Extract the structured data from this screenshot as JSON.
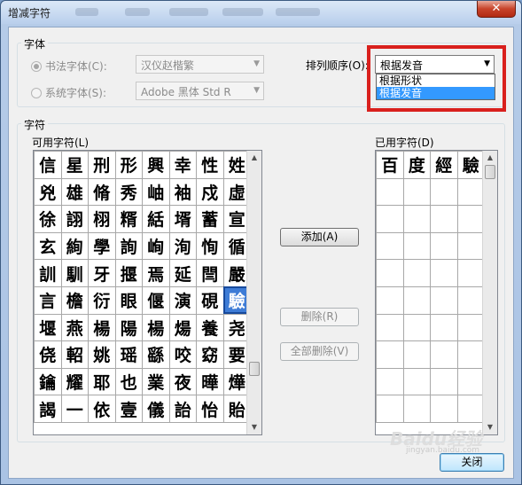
{
  "window": {
    "title": "增减字符",
    "close_glyph": "✕"
  },
  "font_group": {
    "label": "字体",
    "calligraphy_radio": "书法字体(C):",
    "calligraphy_value": "汉仪赵楷繁",
    "system_radio": "系统字体(S):",
    "system_value": "Adobe 黑体 Std R",
    "sort_label": "排列顺序(O):",
    "sort_value": "根据发音",
    "sort_options": [
      "根据形状",
      "根据发音"
    ]
  },
  "char_group": {
    "label": "字符",
    "available_label": "可用字符(L)",
    "used_label": "已用字符(D)",
    "available_rows": [
      [
        "信",
        "星",
        "刑",
        "形",
        "興",
        "幸",
        "性",
        "姓"
      ],
      [
        "兇",
        "雄",
        "脩",
        "秀",
        "岫",
        "袖",
        "戍",
        "虛"
      ],
      [
        "徐",
        "詡",
        "栩",
        "糈",
        "絬",
        "壻",
        "蓄",
        "宣"
      ],
      [
        "玄",
        "絢",
        "學",
        "詢",
        "峋",
        "洵",
        "恂",
        "循"
      ],
      [
        "訓",
        "馴",
        "牙",
        "揠",
        "焉",
        "延",
        "閆",
        "嚴"
      ],
      [
        "言",
        "檐",
        "衍",
        "眼",
        "偃",
        "演",
        "硯",
        "驗"
      ],
      [
        "堰",
        "燕",
        "楊",
        "陽",
        "楊",
        "煬",
        "養",
        "尧"
      ],
      [
        "侥",
        "軺",
        "姚",
        "瑶",
        "繇",
        "咬",
        "窈",
        "要"
      ],
      [
        "鑰",
        "耀",
        "耶",
        "也",
        "業",
        "夜",
        "曄",
        "燁"
      ],
      [
        "謁",
        "一",
        "依",
        "壹",
        "儀",
        "詒",
        "怡",
        "貽"
      ]
    ],
    "used_rows": [
      [
        "百",
        "度",
        "經",
        "驗"
      ],
      [
        "",
        "",
        "",
        ""
      ],
      [
        "",
        "",
        "",
        ""
      ],
      [
        "",
        "",
        "",
        ""
      ],
      [
        "",
        "",
        "",
        ""
      ],
      [
        "",
        "",
        "",
        ""
      ],
      [
        "",
        "",
        "",
        ""
      ],
      [
        "",
        "",
        "",
        ""
      ],
      [
        "",
        "",
        "",
        ""
      ],
      [
        "",
        "",
        "",
        ""
      ]
    ]
  },
  "buttons": {
    "add": "添加(A)",
    "delete": "删除(R)",
    "delete_all": "全部删除(V)",
    "close": "关闭"
  },
  "watermark": {
    "main": "Baidu经验",
    "sub": "jingyan.baidu.com"
  },
  "colors": {
    "selection": "#3e7cd6",
    "annotation_box": "#d9201d",
    "dropdown_highlight": "#3399ff"
  }
}
